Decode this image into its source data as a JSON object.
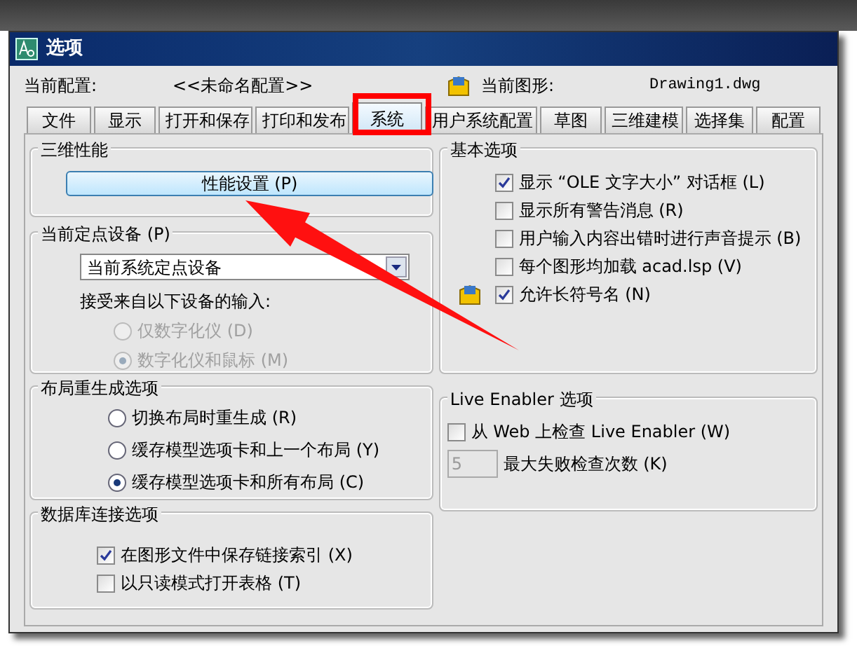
{
  "window": {
    "title": "选项"
  },
  "header": {
    "profile_label": "当前配置:",
    "profile_value": "<<未命名配置>>",
    "drawing_label": "当前图形:",
    "drawing_value": "Drawing1.dwg"
  },
  "tabs": [
    {
      "label": "文件",
      "selected": false
    },
    {
      "label": "显示",
      "selected": false
    },
    {
      "label": "打开和保存",
      "selected": false
    },
    {
      "label": "打印和发布",
      "selected": false
    },
    {
      "label": "系统",
      "selected": true
    },
    {
      "label": "用户系统配置",
      "selected": false
    },
    {
      "label": "草图",
      "selected": false
    },
    {
      "label": "三维建模",
      "selected": false
    },
    {
      "label": "选择集",
      "selected": false
    },
    {
      "label": "配置",
      "selected": false
    }
  ],
  "performance_3d": {
    "title": "三维性能",
    "button": "性能设置 (P)"
  },
  "pointing_device": {
    "title": "当前定点设备 (P)",
    "select_value": "当前系统定点设备",
    "input_label": "接受来自以下设备的输入:",
    "options": [
      {
        "label": "仅数字化仪 (D)",
        "selected": false,
        "disabled": true
      },
      {
        "label": "数字化仪和鼠标 (M)",
        "selected": true,
        "disabled": true
      }
    ]
  },
  "layout_regen": {
    "title": "布局重生成选项",
    "options": [
      {
        "label": "切换布局时重生成 (R)",
        "selected": false
      },
      {
        "label": "缓存模型选项卡和上一个布局 (Y)",
        "selected": false
      },
      {
        "label": "缓存模型选项卡和所有布局 (C)",
        "selected": true
      }
    ]
  },
  "db_connect": {
    "title": "数据库连接选项",
    "options": [
      {
        "label": "在图形文件中保存链接索引 (X)",
        "checked": true
      },
      {
        "label": "以只读模式打开表格 (T)",
        "checked": false
      }
    ]
  },
  "general": {
    "title": "基本选项",
    "options": [
      {
        "label": "显示 “OLE 文字大小” 对话框 (L)",
        "checked": true,
        "saved_in_drawing": false
      },
      {
        "label": "显示所有警告消息 (R)",
        "checked": false,
        "saved_in_drawing": false
      },
      {
        "label": "用户输入内容出错时进行声音提示 (B)",
        "checked": false,
        "saved_in_drawing": false
      },
      {
        "label": "每个图形均加载 acad.lsp (V)",
        "checked": false,
        "saved_in_drawing": false
      },
      {
        "label": "允许长符号名 (N)",
        "checked": true,
        "saved_in_drawing": true
      }
    ]
  },
  "live_enabler": {
    "title": "Live Enabler 选项",
    "check": {
      "label": "从 Web 上检查 Live Enabler (W)",
      "checked": false
    },
    "field": {
      "value": "5",
      "disabled": true
    },
    "field_label": "最大失败检查次数 (K)"
  }
}
